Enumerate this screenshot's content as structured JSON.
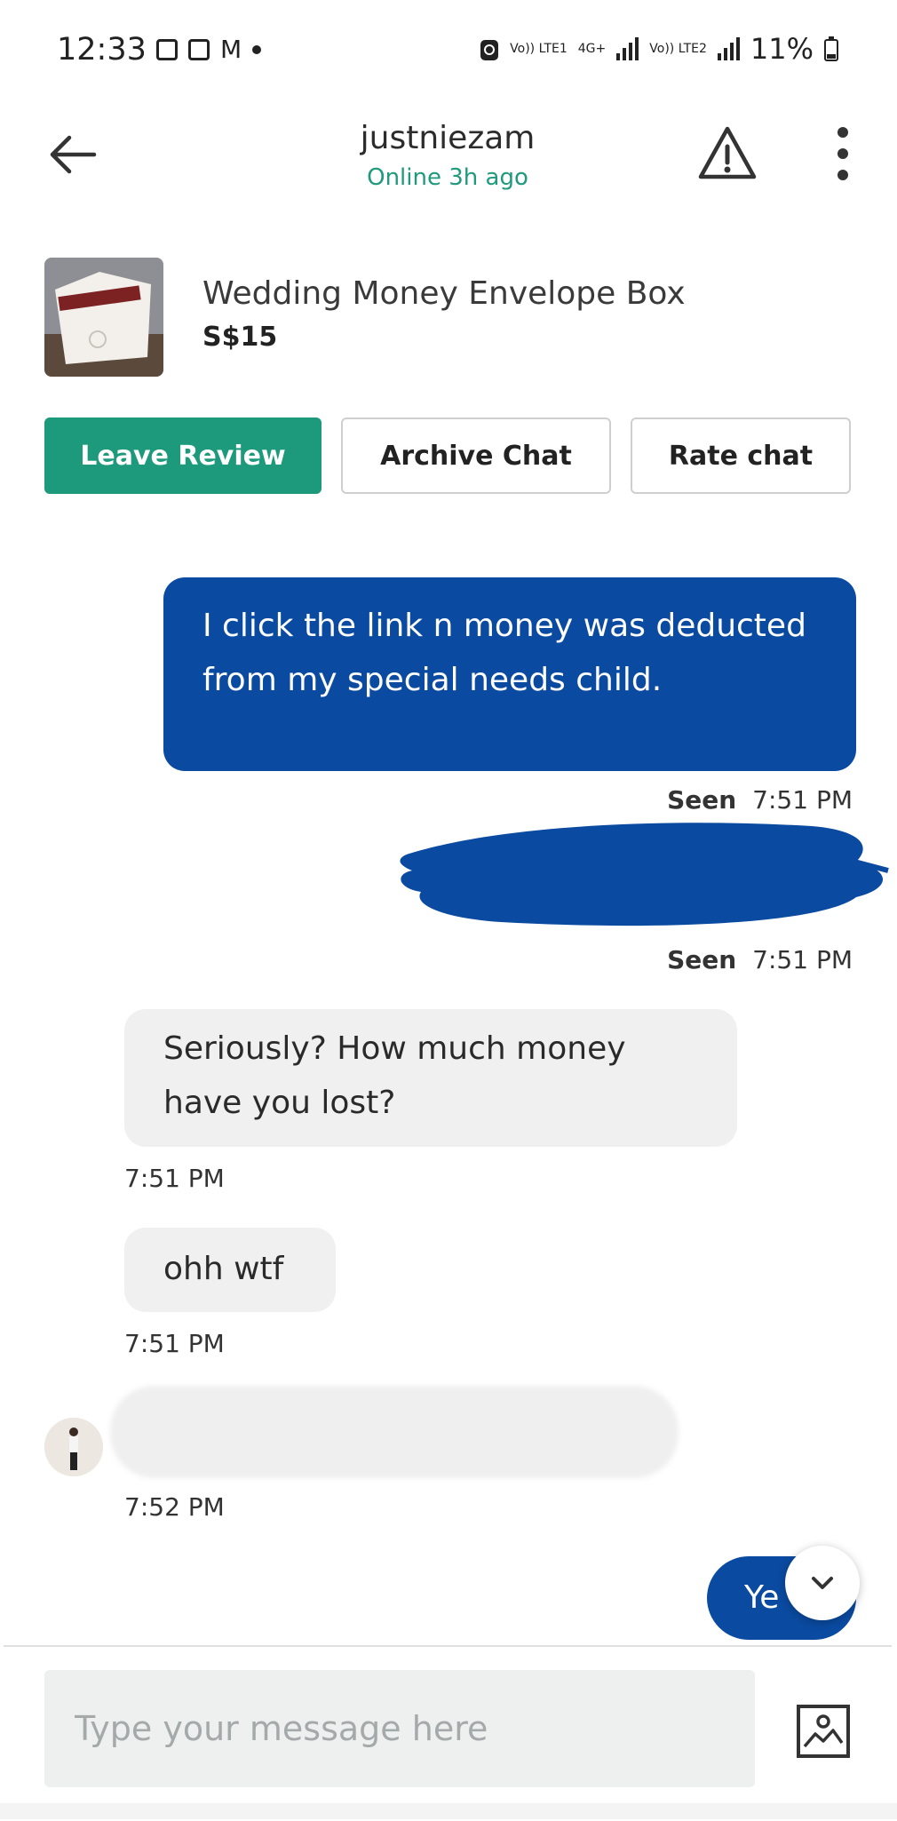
{
  "status_bar": {
    "time": "12:33",
    "network_1": "Vo)) LTE1",
    "network_2": "4G+",
    "network_3": "Vo)) LTE2",
    "battery": "11%"
  },
  "header": {
    "username": "justniezam",
    "online_status": "Online 3h ago"
  },
  "product": {
    "title": "Wedding Money Envelope Box",
    "price": "S$15"
  },
  "actions": {
    "leave_review": "Leave Review",
    "archive_chat": "Archive Chat",
    "rate_chat": "Rate chat"
  },
  "messages": [
    {
      "text": "I click the link n money was deducted from my special needs child.",
      "seen": "Seen",
      "time": "7:51 PM"
    },
    {
      "seen": "Seen",
      "time": "7:51 PM"
    },
    {
      "text": "Seriously? How much money have you lost?",
      "time": "7:51 PM"
    },
    {
      "text": "ohh wtf",
      "time": "7:51 PM"
    },
    {
      "time": "7:52 PM"
    },
    {
      "text": "Ye"
    }
  ],
  "composer": {
    "placeholder": "Type your message here"
  },
  "colors": {
    "accent_green": "#1c9a7b",
    "outgoing_blue": "#0a4aa0",
    "incoming_grey": "#f0f0f0"
  }
}
